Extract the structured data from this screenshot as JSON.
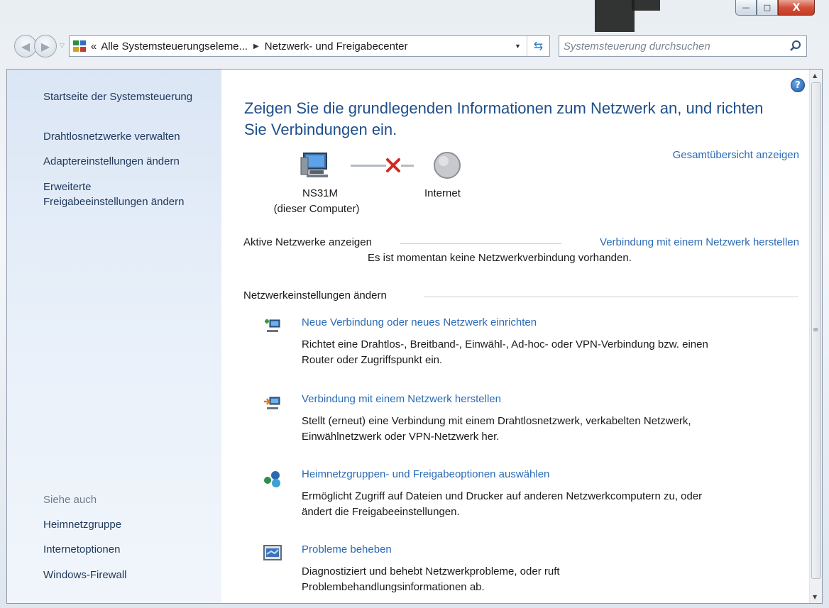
{
  "window": {
    "caption_buttons": {
      "minimize": "—",
      "maximize": "□",
      "close": "X"
    }
  },
  "nav": {
    "back_icon": "back-arrow-icon",
    "forward_icon": "forward-arrow-icon",
    "breadcrumb_prefix": "«",
    "breadcrumb_1": "Alle Systemsteuerungseleme...",
    "breadcrumb_separator": "▶",
    "breadcrumb_2": "Netzwerk- und Freigabecenter",
    "search_placeholder": "Systemsteuerung durchsuchen"
  },
  "sidebar": {
    "links": [
      "Startseite der Systemsteuerung",
      "Drahtlosnetzwerke verwalten",
      "Adaptereinstellungen ändern",
      "Erweiterte",
      "Freigabeeinstellungen ändern"
    ],
    "see_also_heading": "Siehe auch",
    "see_also": [
      "Heimnetzgruppe",
      "Internetoptionen",
      "Windows-Firewall"
    ]
  },
  "main": {
    "title_line1": "Zeigen Sie die grundlegenden Informationen zum Netzwerk an, und richten",
    "title_line2": "Sie Verbindungen ein.",
    "full_map_link": "Gesamtübersicht anzeigen",
    "computer_name": "NS31M",
    "computer_sub": "(dieser Computer)",
    "internet_label": "Internet",
    "active_networks_label": "Aktive Netzwerke anzeigen",
    "connect_link": "Verbindung mit einem Netzwerk herstellen",
    "no_connection_text": "Es ist momentan keine Netzwerkverbindung vorhanden.",
    "change_settings_label": "Netzwerkeinstellungen ändern",
    "tasks": [
      {
        "title": "Neue Verbindung oder neues Netzwerk einrichten",
        "desc1": "Richtet eine Drahtlos-, Breitband-, Einwähl-, Ad-hoc- oder VPN-Verbindung bzw. einen",
        "desc2": "Router oder Zugriffspunkt ein."
      },
      {
        "title": "Verbindung mit einem Netzwerk herstellen",
        "desc1": "Stellt (erneut) eine Verbindung mit einem Drahtlosnetzwerk, verkabelten Netzwerk,",
        "desc2": "Einwählnetzwerk oder VPN-Netzwerk her."
      },
      {
        "title": "Heimnetzgruppen- und Freigabeoptionen auswählen",
        "desc1": "Ermöglicht Zugriff auf Dateien und Drucker auf anderen Netzwerkcomputern zu, oder",
        "desc2": "ändert die Freigabeeinstellungen."
      },
      {
        "title": "Probleme beheben",
        "desc1": "Diagnostiziert und behebt Netzwerkprobleme, oder ruft",
        "desc2": "Problembehandlungsinformationen ab."
      }
    ]
  }
}
